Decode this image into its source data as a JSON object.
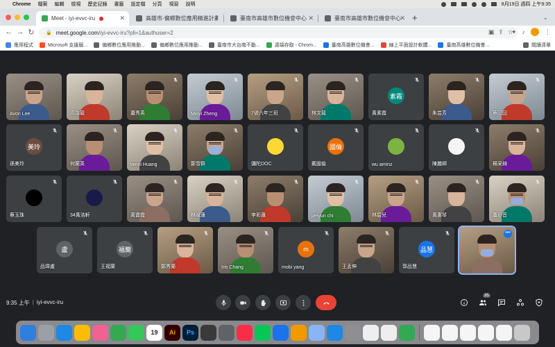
{
  "menubar": {
    "apple": "",
    "items": [
      "Chrome",
      "檔案",
      "編輯",
      "檢視",
      "歷史記錄",
      "書籤",
      "設定檔",
      "分頁",
      "視窗",
      "說明"
    ],
    "datetime": "8月19日 週四 上午9:35"
  },
  "tabs": [
    {
      "title": "Meet - iyi-evvc-iru",
      "favicon_color": "#34a853"
    },
    {
      "title": "高雄市-偏鄉數位應用精進計畫",
      "favicon_color": "#5f6368"
    },
    {
      "title": "臺南市高雄市數位機會中心",
      "favicon_color": "#5f6368"
    },
    {
      "title": "臺南市高雄市數位機會中心",
      "favicon_color": "#5f6368"
    }
  ],
  "toolbar": {
    "url_host": "meet.google.com",
    "url_path": "/iyi-evvc-iru?pli=1&authuser=2",
    "profile_initial": "ISL"
  },
  "bookmarks": {
    "items": [
      {
        "label": "應用程式",
        "color": "#4285f4"
      },
      {
        "label": "Microsoft 支援服...",
        "color": "#f25022"
      },
      {
        "label": "偏鄉數位應用推動...",
        "color": "#5f6368"
      },
      {
        "label": "偏鄉數位應用推動...",
        "color": "#5f6368"
      },
      {
        "label": "臺南市大台南不動...",
        "color": "#5f6368"
      },
      {
        "label": "遠端存取 - Chrom...",
        "color": "#34a853"
      },
      {
        "label": "臺南高雄數位機會...",
        "color": "#1a73e8"
      },
      {
        "label": "線上平面設計軟體...",
        "color": "#ea4335"
      },
      {
        "label": "臺南高雄數位機會...",
        "color": "#1877f2"
      }
    ],
    "reading_list": "閱讀清單"
  },
  "participants": [
    {
      "name": "Avon Lee",
      "type": "cam",
      "muted": false
    },
    {
      "name": "高誌龍",
      "type": "cam",
      "muted": false
    },
    {
      "name": "蕭秀英",
      "type": "cam",
      "muted": true
    },
    {
      "name": "Mioyi Zheng",
      "type": "cam",
      "muted": true
    },
    {
      "name": "7號六年三班",
      "type": "cam",
      "muted": true
    },
    {
      "name": "林文龍",
      "type": "cam",
      "muted": true
    },
    {
      "name": "黃素霞",
      "type": "avatar",
      "initials": "素霞",
      "color": "#00897b",
      "muted": true
    },
    {
      "name": "朱芸芳",
      "type": "cam",
      "muted": true
    },
    {
      "name": "蔡囧囧",
      "type": "cam",
      "muted": true
    },
    {
      "name": "孫美玲",
      "type": "avatar",
      "initials": "美玲",
      "color": "#6d4c41",
      "muted": true
    },
    {
      "name": "何蘭英",
      "type": "cam",
      "muted": true
    },
    {
      "name": "winni Huang",
      "type": "cam",
      "muted": true
    },
    {
      "name": "鄭雪群",
      "type": "cam",
      "muted": true
    },
    {
      "name": "彌陀DOC",
      "type": "avatar",
      "initials": "",
      "color": "#fdd835",
      "muted": true
    },
    {
      "name": "戴國倫",
      "type": "avatar",
      "initials": "國倫",
      "color": "#e8710a",
      "muted": true
    },
    {
      "name": "wu aminz",
      "type": "avatar",
      "initials": "",
      "color": "#7cb342",
      "muted": true
    },
    {
      "name": "陳麗卿",
      "type": "avatar",
      "initials": "",
      "color": "#f5f5f5",
      "muted": true
    },
    {
      "name": "楊采錡",
      "type": "cam",
      "muted": true
    },
    {
      "name": "蔡玉珠",
      "type": "avatar",
      "initials": "",
      "color": "#000000",
      "muted": true
    },
    {
      "name": "34黃浩軒",
      "type": "avatar",
      "initials": "",
      "color": "#1a1a4a",
      "muted": true
    },
    {
      "name": "黃寶霞",
      "type": "cam",
      "muted": true
    },
    {
      "name": "林賦蓮",
      "type": "cam",
      "muted": true
    },
    {
      "name": "李彩蓮",
      "type": "cam",
      "muted": true
    },
    {
      "name": "peiyun chi",
      "type": "cam",
      "muted": true
    },
    {
      "name": "林碧兒",
      "type": "cam",
      "muted": true
    },
    {
      "name": "黃惠琴",
      "type": "cam",
      "muted": true
    },
    {
      "name": "蕭舒音",
      "type": "cam",
      "muted": true
    },
    {
      "name": "品瑋盧",
      "type": "avatar",
      "initials": "盧",
      "color": "#5f6368",
      "muted": true
    },
    {
      "name": "王福蘭",
      "type": "avatar",
      "initials": "福蘭",
      "color": "#5f6368",
      "muted": true
    },
    {
      "name": "鄭秀蘭",
      "type": "cam",
      "muted": true
    },
    {
      "name": "Iris Chang",
      "type": "cam",
      "muted": true
    },
    {
      "name": "mobi yang",
      "type": "avatar",
      "initials": "m",
      "color": "#e8710a",
      "muted": true
    },
    {
      "name": "王孟伸",
      "type": "cam",
      "muted": true
    },
    {
      "name": "郭品慧",
      "type": "avatar",
      "initials": "品慧",
      "color": "#1a73e8",
      "muted": true
    },
    {
      "name": "",
      "type": "cam",
      "muted": false,
      "active": true
    }
  ],
  "controls": {
    "time": "9:35 上午",
    "separator": "|",
    "meeting_code": "iyi-evvc-iru",
    "participant_count": "35"
  },
  "dock": [
    {
      "name": "finder",
      "color": "#2f7fe0",
      "label": ""
    },
    {
      "name": "launchpad",
      "color": "#9aa0a6",
      "label": ""
    },
    {
      "name": "safari",
      "color": "#1e88e5",
      "label": ""
    },
    {
      "name": "chrome",
      "color": "#fbbc05",
      "label": ""
    },
    {
      "name": "photos",
      "color": "#f06292",
      "label": ""
    },
    {
      "name": "facetime",
      "color": "#34a853",
      "label": ""
    },
    {
      "name": "messages",
      "color": "#34c759",
      "label": ""
    },
    {
      "name": "calendar",
      "color": "#ffffff",
      "label": "19"
    },
    {
      "name": "illustrator",
      "color": "#330000",
      "label": "Ai"
    },
    {
      "name": "photoshop",
      "color": "#001e36",
      "label": "Ps"
    },
    {
      "name": "finalcut",
      "color": "#3a3a3a",
      "label": ""
    },
    {
      "name": "quicktime",
      "color": "#5f6368",
      "label": ""
    },
    {
      "name": "music",
      "color": "#fa2d48",
      "label": ""
    },
    {
      "name": "line",
      "color": "#06c755",
      "label": ""
    },
    {
      "name": "keynote",
      "color": "#1a73e8",
      "label": ""
    },
    {
      "name": "pages",
      "color": "#f29900",
      "label": ""
    },
    {
      "name": "preview",
      "color": "#8ab4f8",
      "label": ""
    },
    {
      "name": "appstore",
      "color": "#1e88e5",
      "label": ""
    },
    {
      "name": "settings",
      "color": "#8e8e93",
      "label": ""
    },
    {
      "name": "textedit",
      "color": "#eeeeee",
      "label": ""
    },
    {
      "name": "notes",
      "color": "#eeeeee",
      "label": ""
    },
    {
      "name": "numbers",
      "color": "#34a853",
      "label": ""
    },
    {
      "name": "doc1",
      "color": "#f5f5f5",
      "label": ""
    },
    {
      "name": "doc2",
      "color": "#f5f5f5",
      "label": ""
    },
    {
      "name": "doc3",
      "color": "#f5f5f5",
      "label": ""
    },
    {
      "name": "doc4",
      "color": "#f5f5f5",
      "label": ""
    },
    {
      "name": "doc5",
      "color": "#f5f5f5",
      "label": ""
    },
    {
      "name": "trash",
      "color": "#c8c8c8",
      "label": ""
    }
  ]
}
